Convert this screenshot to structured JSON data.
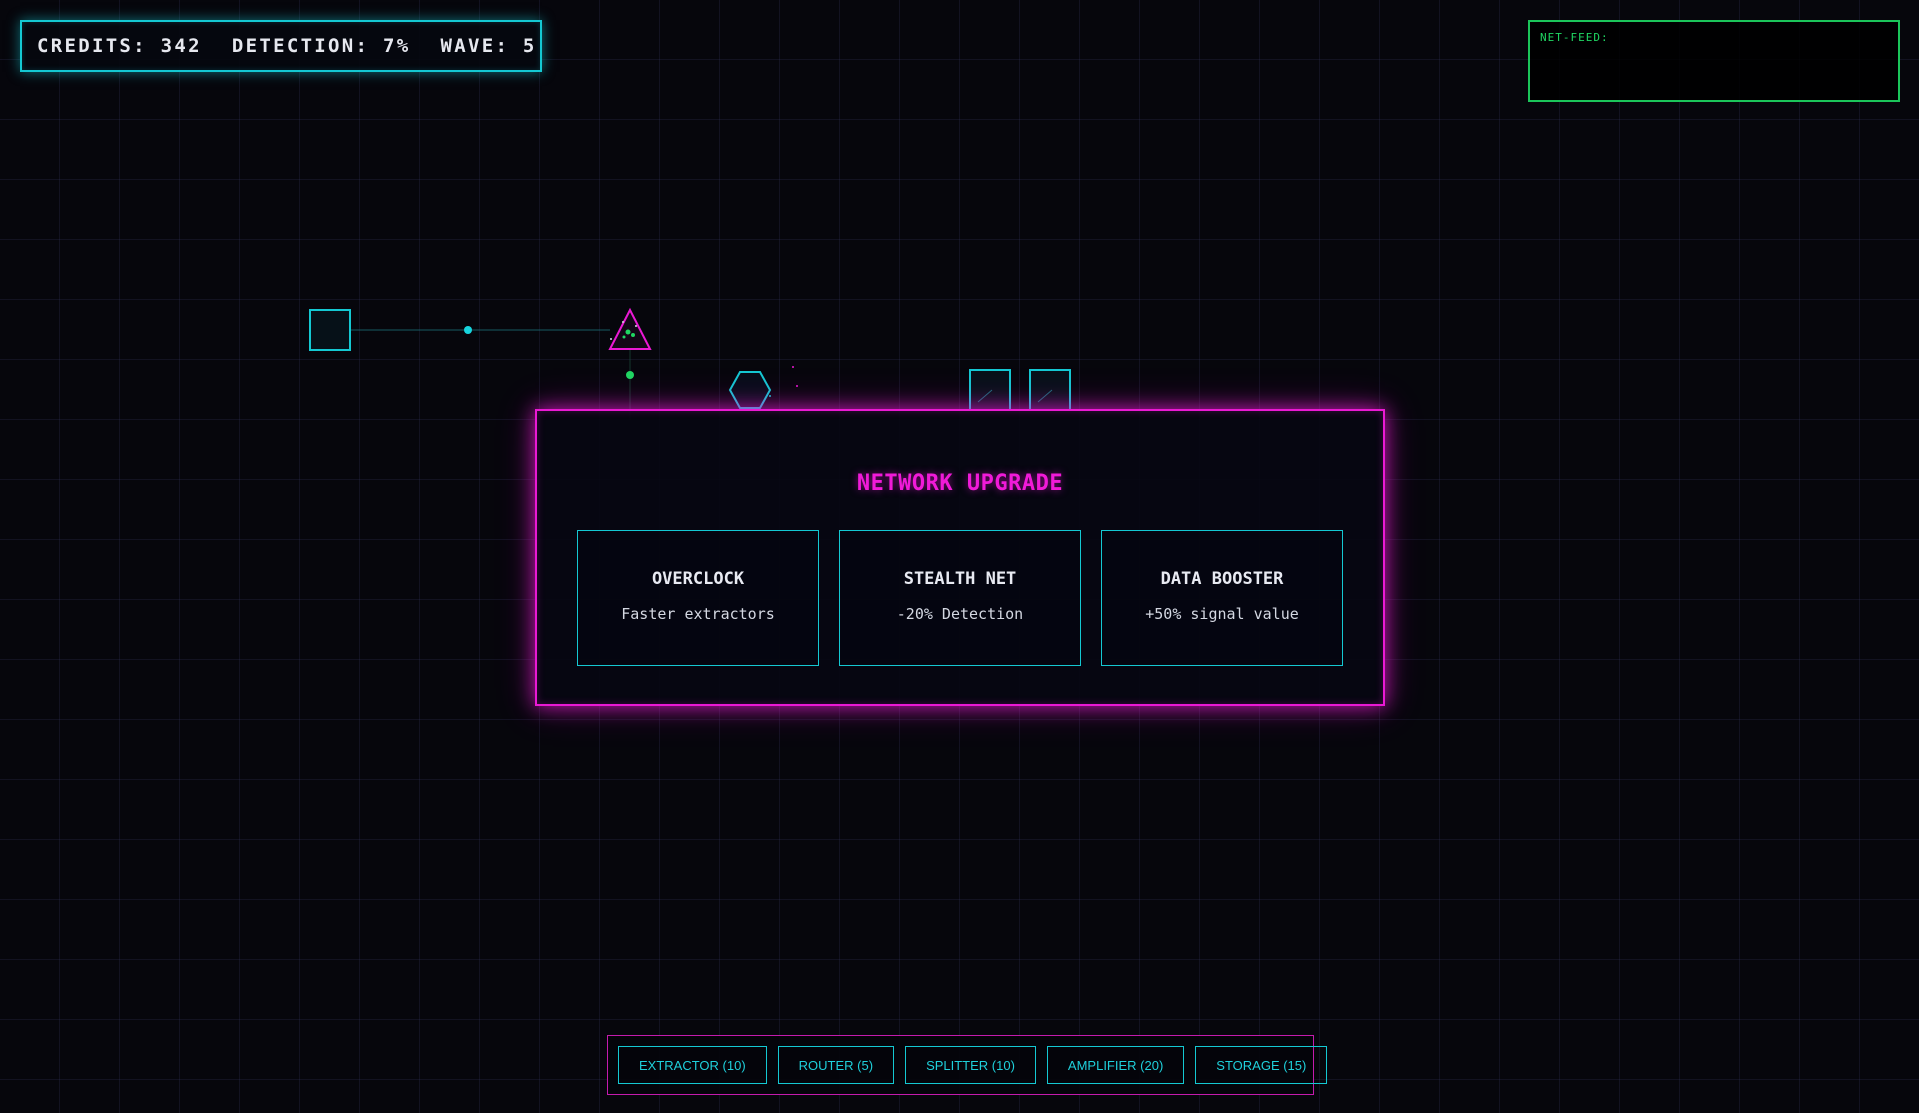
{
  "hud": {
    "credits": "CREDITS: 342",
    "detection": "DETECTION: 7%",
    "wave": "WAVE: 5"
  },
  "netfeed": {
    "label": "NET-FEED:"
  },
  "modal": {
    "title": "NETWORK UPGRADE",
    "options": [
      {
        "name": "OVERCLOCK",
        "desc": "Faster extractors"
      },
      {
        "name": "STEALTH NET",
        "desc": "-20% Detection"
      },
      {
        "name": "DATA BOOSTER",
        "desc": "+50% signal value"
      }
    ]
  },
  "toolbar": {
    "buttons": [
      "EXTRACTOR (10)",
      "ROUTER (5)",
      "SPLITTER (10)",
      "AMPLIFIER (20)",
      "STORAGE (15)"
    ]
  },
  "colors": {
    "cyan": "#14c8d2",
    "magenta": "#ea19d4",
    "green": "#1bc55a",
    "background": "#06060c"
  },
  "nodes": [
    {
      "type": "square-node"
    },
    {
      "type": "triangle-node"
    },
    {
      "type": "hexagon-node"
    },
    {
      "type": "square-node"
    },
    {
      "type": "square-node"
    }
  ]
}
